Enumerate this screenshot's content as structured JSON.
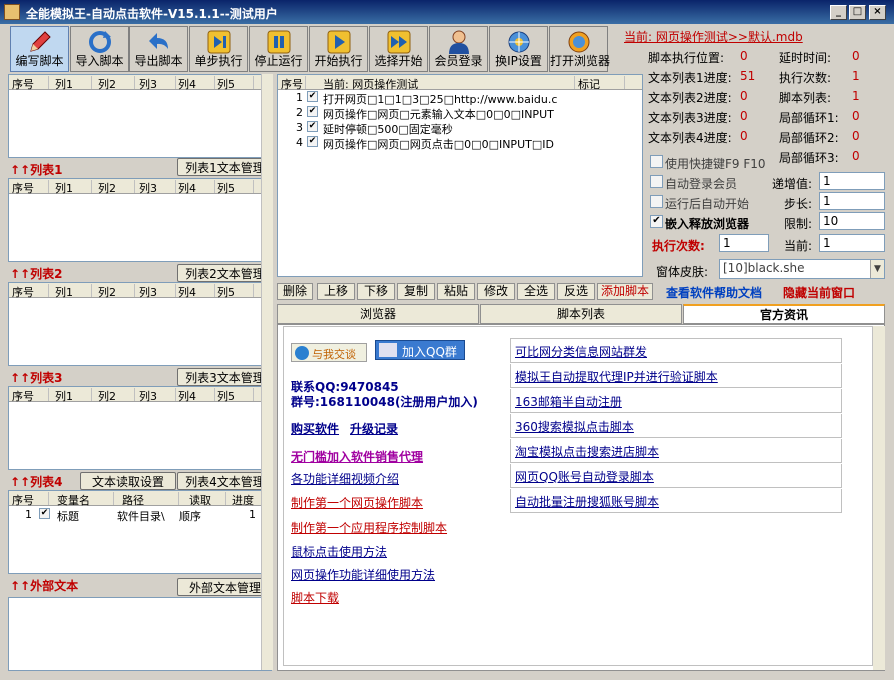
{
  "window": {
    "title": "全能模拟王-自动点击软件-V15.1.1--测试用户",
    "minimize": "_",
    "maximize": "□",
    "close": "×"
  },
  "toolbar": [
    {
      "label": "编写脚本",
      "icon": "pencil-icon"
    },
    {
      "label": "导入脚本",
      "icon": "refresh-icon"
    },
    {
      "label": "导出脚本",
      "icon": "undo-arrow-icon"
    },
    {
      "label": "单步执行",
      "icon": "step-forward-icon"
    },
    {
      "label": "停止运行",
      "icon": "pause-icon"
    },
    {
      "label": "开始执行",
      "icon": "play-icon"
    },
    {
      "label": "选择开始",
      "icon": "fast-forward-icon"
    },
    {
      "label": "会员登录",
      "icon": "user-icon"
    },
    {
      "label": "换IP设置",
      "icon": "network-icon"
    },
    {
      "label": "打开浏览器",
      "icon": "browser-icon"
    }
  ],
  "columns": [
    "序号",
    "列1",
    "列2",
    "列3",
    "列4",
    "列5"
  ],
  "lists": {
    "list1": {
      "title": "↑↑列表1",
      "manage": "列表1文本管理"
    },
    "list2": {
      "title": "↑↑列表2",
      "manage": "列表2文本管理"
    },
    "list3": {
      "title": "↑↑列表3",
      "manage": "列表3文本管理"
    },
    "list4": {
      "title": "↑↑列表4",
      "read_settings": "文本读取设置",
      "manage": "列表4文本管理"
    },
    "external": {
      "title": "↑↑外部文本",
      "manage": "外部文本管理"
    }
  },
  "list4_table": {
    "columns": [
      "序号",
      "变量名",
      "路径",
      "读取",
      "进度"
    ],
    "rows": [
      {
        "no": "1",
        "name": "标题",
        "path": "软件目录\\",
        "read": "顺序",
        "progress": "1"
      }
    ]
  },
  "script_table": {
    "columns": [
      "序号",
      "当前: 网页操作测试",
      "标记"
    ],
    "rows": [
      {
        "no": "1",
        "text": "打开网页□1□1□3□25□http://www.baidu.c"
      },
      {
        "no": "2",
        "text": "网页操作□网页□元素输入文本□0□0□INPUT"
      },
      {
        "no": "3",
        "text": "延时停顿□500□固定毫秒"
      },
      {
        "no": "4",
        "text": "网页操作□网页□网页点击□0□0□INPUT□ID"
      }
    ]
  },
  "current_file": "当前: 网页操作测试>>默认.mdb",
  "status": {
    "left": [
      {
        "label": "脚本执行位置:",
        "value": "0"
      },
      {
        "label": "文本列表1进度:",
        "value": "51"
      },
      {
        "label": "文本列表2进度:",
        "value": "0"
      },
      {
        "label": "文本列表3进度:",
        "value": "0"
      },
      {
        "label": "文本列表4进度:",
        "value": "0"
      }
    ],
    "right": [
      {
        "label": "延时时间:",
        "value": "0"
      },
      {
        "label": "执行次数:",
        "value": "1"
      },
      {
        "label": "脚本列表:",
        "value": "1"
      },
      {
        "label": "局部循环1:",
        "value": "0"
      },
      {
        "label": "局部循环2:",
        "value": "0"
      },
      {
        "label": "局部循环3:",
        "value": "0"
      }
    ]
  },
  "options": {
    "hotkey": "使用快捷键F9 F10",
    "auto_login": "自动登录会员",
    "auto_start": "运行后自动开始",
    "embed_browser": "嵌入释放浏览器",
    "increment_label": "递增值:",
    "increment_value": "1",
    "step_label": "步长:",
    "step_value": "1",
    "limit_label": "限制:",
    "limit_value": "10",
    "exec_label": "执行次数:",
    "exec_value": "1",
    "current_label": "当前:",
    "current_value": "1",
    "skin_label": "窗体皮肤:",
    "skin_value": "[10]black.she"
  },
  "script_buttons": [
    "删除",
    "上移",
    "下移",
    "复制",
    "粘贴",
    "修改",
    "全选",
    "反选",
    "添加脚本"
  ],
  "help_link": "查看软件帮助文档",
  "hide_window": "隐藏当前窗口",
  "tabs": [
    "浏览器",
    "脚本列表",
    "官方资讯"
  ],
  "news": {
    "chat_btn": "与我交谈",
    "qq_group_btn": "加入QQ群",
    "contact": "联系QQ:9470845",
    "group": "群号:168110048(注册用户加入)",
    "buy": "购买软件",
    "upgrade": "升级记录",
    "agent": "无门槛加入软件销售代理",
    "left_links": [
      "各功能详细视频介绍",
      "制作第一个网页操作脚本",
      "制作第一个应用程序控制脚本",
      "鼠标点击使用方法",
      "网页操作功能详细使用方法",
      "脚本下载"
    ],
    "right_links": [
      "可比网分类信息网站群发",
      "模拟王自动提取代理IP并进行验证脚本",
      "163邮箱半自动注册",
      "360搜索模拟点击脚本",
      "淘宝模拟点击搜索进店脚本",
      "网页QQ账号自动登录脚本",
      "自动批量注册搜狐账号脚本"
    ]
  },
  "colors": {
    "accent_red": "#c00000",
    "link_blue": "#00008b",
    "title_bar": "#0a246a"
  }
}
